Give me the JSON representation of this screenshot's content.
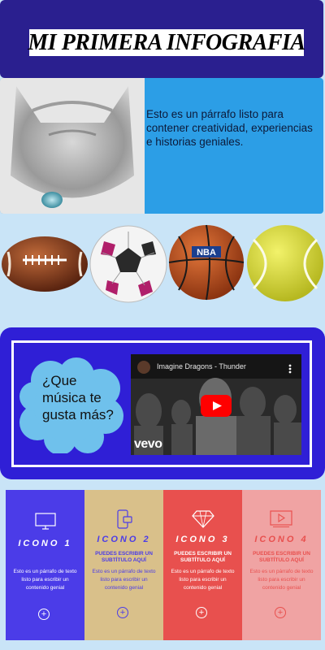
{
  "header": {
    "title": "MI PRIMERA INFOGRAFIA"
  },
  "intro": {
    "paragraph": "Esto es un párrafo listo para contener creatividad, experiencias e historias geniales."
  },
  "music": {
    "question": "¿Que música te gusta más?",
    "video": {
      "title": "Imagine Dragons - Thunder",
      "brand": "vevo"
    }
  },
  "cards": [
    {
      "title": "ICONO 1",
      "subtitle": "",
      "text": "Esto es un párrafo de texto listo para escribir un contenido genial",
      "icon": "monitor-icon",
      "color": "#4b3ce8"
    },
    {
      "title": "ICONO 2",
      "subtitle": "PUEDES ESCRIBIR UN SUBTÍTULO AQUÍ",
      "text": "Esto es un párrafo de texto listo para escribir un contenido genial",
      "icon": "phone-chat-icon",
      "color": "#d9c08a"
    },
    {
      "title": "ICONO 3",
      "subtitle": "PUEDES ESCRIBIR UN SUBTÍTULO AQUÍ",
      "text": "Esto es un párrafo de texto listo para escribir un contenido genial",
      "icon": "diamond-icon",
      "color": "#e8504e"
    },
    {
      "title": "ICONO 4",
      "subtitle": "PUEDES ESCRIBIR UN SUBTÍTULO AQUÍ",
      "text": "Esto es un párrafo de texto listo para escribir un contenido genial",
      "icon": "video-player-icon",
      "color": "#f0a3a3"
    }
  ],
  "colors": {
    "header_bg": "#2a1f8f",
    "intro_bg": "#2c9ee6",
    "music_bg": "#2f1fd6",
    "page_bg": "#c9e4f7"
  }
}
